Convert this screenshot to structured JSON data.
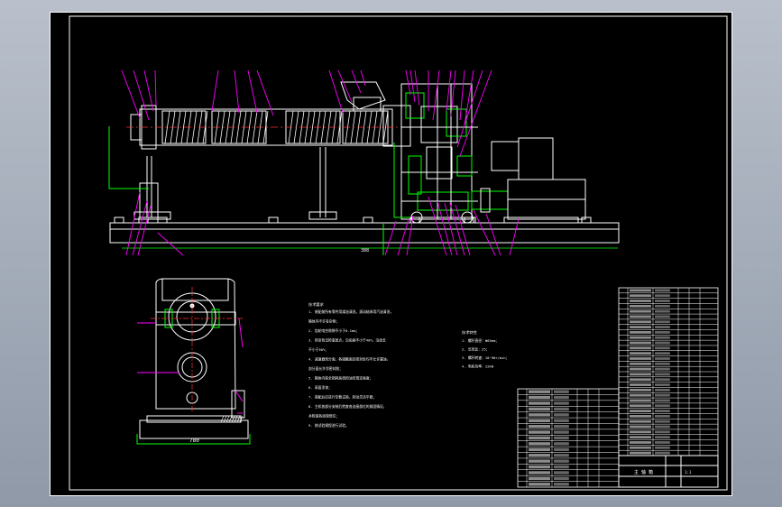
{
  "colors": {
    "background": "#000000",
    "viewport": "#a9b2bf",
    "frame": "#ffffff",
    "leader": "#ff00ff",
    "component": "#00ff00",
    "dimension": "#00ff00",
    "hatch": "#ffffff"
  },
  "drawing": {
    "main_view_dimension": "388",
    "side_view_dimension": "780",
    "title_block": {
      "title": "主 轴 箱",
      "scale": "1:1"
    }
  },
  "tech_notes_left": {
    "heading": "技术要求",
    "lines": [
      "1. 装配前所有零件用煤油清洗，滚动轴承用汽油清洗，",
      "   箱体内不许有杂物；",
      "2. 齿轮啮合侧隙不小于0.1mm；",
      "3. 用涂色法检查斑点，沿齿高不小于40%，沿齿长",
      "   不小于50%；",
      "4. 减速器剖分面、各接触面及密封处均不允许漏油，",
      "   剖分面允许涂密封胶；",
      "5. 箱体内装全损耗系统用油至规定高度；",
      "6. 表面涂漆；",
      "7. 装配后应进行空载试验，转动灵活平稳；",
      "8. 主机各部分安装后检查各连接部位的紧固情况，",
      "   并检查各润滑部位；",
      "9. 按试验规程进行试验。"
    ]
  },
  "tech_notes_right": {
    "heading": "技术特性",
    "lines": [
      "1. 螺杆直径：Φ65mm；",
      "2. 长径比：25；",
      "3. 螺杆转速：10~90r/min；",
      "4. 电机功率：22kW"
    ]
  }
}
